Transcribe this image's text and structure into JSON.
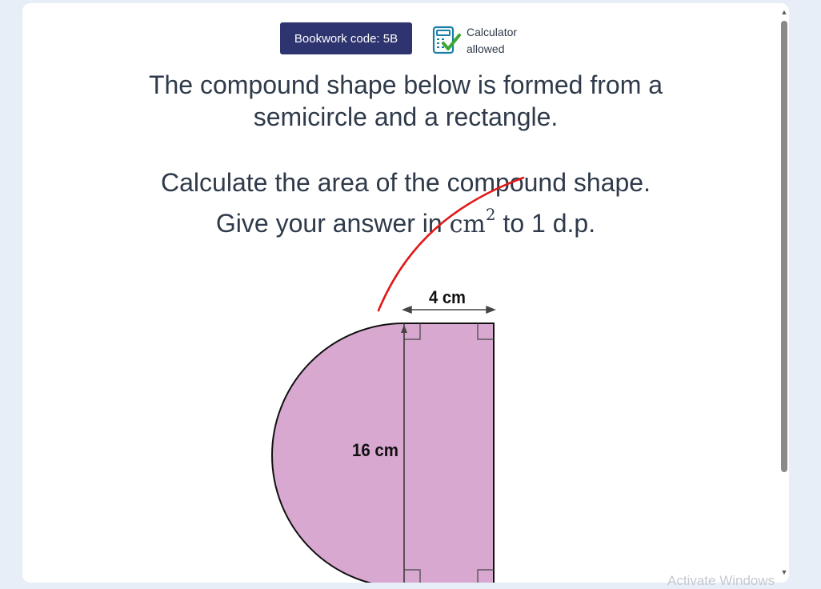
{
  "header": {
    "bookwork_label": "Bookwork code: 5B",
    "calculator_line1": "Calculator",
    "calculator_line2": "allowed",
    "calculator_icon": "calculator-check-icon"
  },
  "question": {
    "line1": "The compound shape below is formed from a",
    "line2": "semicircle and a rectangle.",
    "line3": "Calculate the area of the compound shape.",
    "line4_prefix": "Give your answer in ",
    "unit": "cm",
    "unit_power": "2",
    "line4_suffix": " to 1 d.p."
  },
  "diagram": {
    "width_label": "4 cm",
    "height_label": "16 cm",
    "shape_fill": "#d8a8d0",
    "outline_color": "#111111",
    "annotation_color": "#e01a1a"
  },
  "system": {
    "watermark": "Activate Windows"
  }
}
